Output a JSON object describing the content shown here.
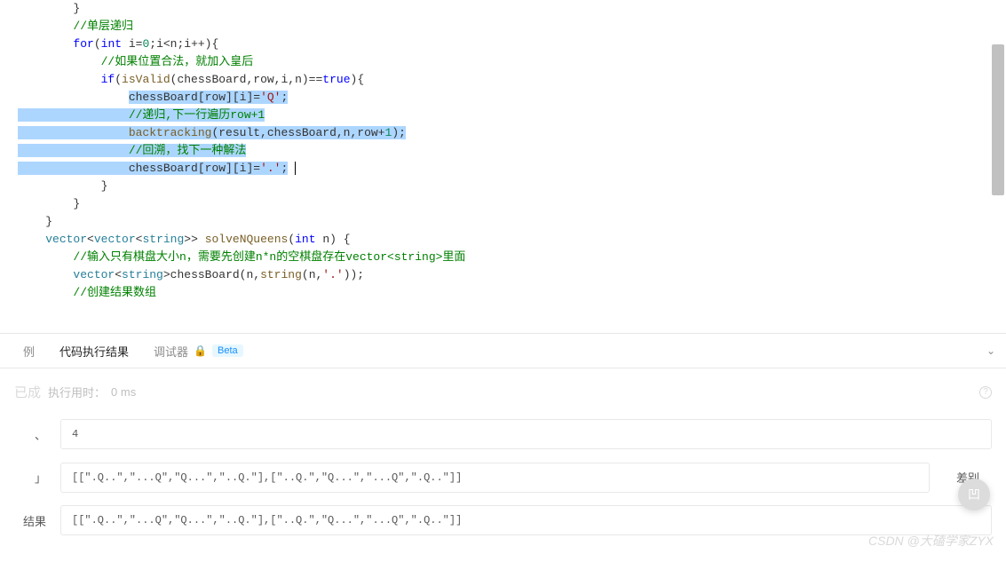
{
  "code": {
    "l1": "        }",
    "l2": "        //单层递归",
    "l3a": "        for(int i=0;i<n;i++){",
    "l4": "            //如果位置合法，就加入皇后",
    "l5a": "            if(isValid(chessBoard,row,i,n)==true){",
    "l6": "chessBoard[row][i]='Q';",
    "l7": "//递归,下一行遍历row+1",
    "l8": "backtracking(result,chessBoard,n,row+1);",
    "l9": "//回溯，找下一种解法",
    "l10": "chessBoard[row][i]='.';",
    "l11": "            }",
    "l12": "",
    "l13": "        }",
    "l14": "",
    "l15": "    }",
    "l16a": "    vector<vector<string>> solveNQueens(int n) {",
    "l17": "        //输入只有棋盘大小n，需要先创建n*n的空棋盘存在vector<string>里面",
    "l18": "        vector<string>chessBoard(n,string(n,'.'));",
    "l19": "        //创建结果数组",
    "kw_for": "for",
    "kw_int": "int",
    "kw_if": "if",
    "kw_true": "true",
    "fn_isValid": "isValid",
    "fn_backtracking": "backtracking",
    "fn_solve": "solveNQueens",
    "fn_string": "string",
    "type_vector": "vector",
    "type_string": "string",
    "str_Q": "'Q'",
    "str_dot": "'.'",
    "pad16": "                "
  },
  "tabs": {
    "example": "例",
    "result": "代码执行结果",
    "debugger": "调试器",
    "beta": "Beta"
  },
  "result": {
    "status": "已成",
    "time_label": "执行用时：",
    "time_value": "0 ms",
    "input_label": "、",
    "input_value": "4",
    "output_label": "」",
    "output_value": "[[\".Q..\",\"...Q\",\"Q...\",\"..Q.\"],[\"..Q.\",\"Q...\",\"...Q\",\".Q..\"]]",
    "expected_label": "结果",
    "expected_value": "[[\".Q..\",\"...Q\",\"Q...\",\"..Q.\"],[\"..Q.\",\"Q...\",\"...Q\",\".Q..\"]]",
    "diff": "差别"
  },
  "watermark": "CSDN @大磕学家ZYX",
  "float_btn": "凹"
}
